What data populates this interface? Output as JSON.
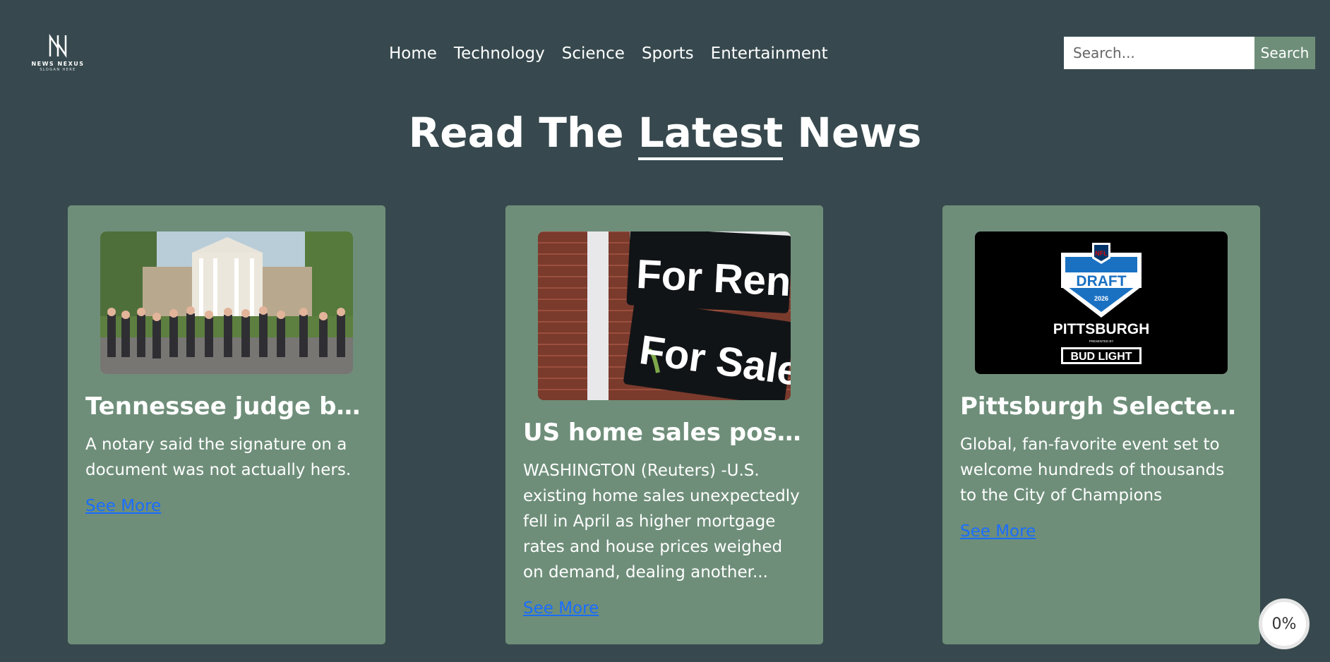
{
  "logo": {
    "brand": "NEWS NEXUS",
    "slogan": "SLOGAN HERE",
    "icon": "nn-monogram-icon"
  },
  "nav": {
    "items": [
      "Home",
      "Technology",
      "Science",
      "Sports",
      "Entertainment"
    ]
  },
  "search": {
    "placeholder": "Search...",
    "button_label": "Search"
  },
  "headline": {
    "before": "Read The ",
    "accent": "Latest",
    "after": " News"
  },
  "cards": [
    {
      "title": "Tennessee judge block...",
      "description": "A notary said the signature on a document was not actually hers.",
      "link_label": "See More",
      "image": "mansion-crowd-photo"
    },
    {
      "title": "US home sales post se...",
      "description": "WASHINGTON (Reuters) -U.S. existing home sales unexpectedly fell in April as higher mortgage rates and house prices weighed on demand, dealing another...",
      "link_label": "See More",
      "image": "for-rent-for-sale-sign-photo",
      "sign_lines": [
        "For Rent",
        "For Sale"
      ]
    },
    {
      "title": "Pittsburgh Selected to...",
      "description": "Global, fan-favorite event set to welcome hundreds of thousands to the City of Champions",
      "link_label": "See More",
      "image": "nfl-draft-logo",
      "draft_text": {
        "nfl": "NFL",
        "draft": "DRAFT",
        "year": "2026",
        "city": "PITTSBURGH",
        "presented": "PRESENTED BY",
        "sponsor": "BUD LIGHT"
      }
    }
  ],
  "progress": {
    "label": "0%"
  },
  "colors": {
    "background": "#37494e",
    "card": "#6e8e79",
    "link": "#1a6dff",
    "search_button": "#6e8e79"
  }
}
